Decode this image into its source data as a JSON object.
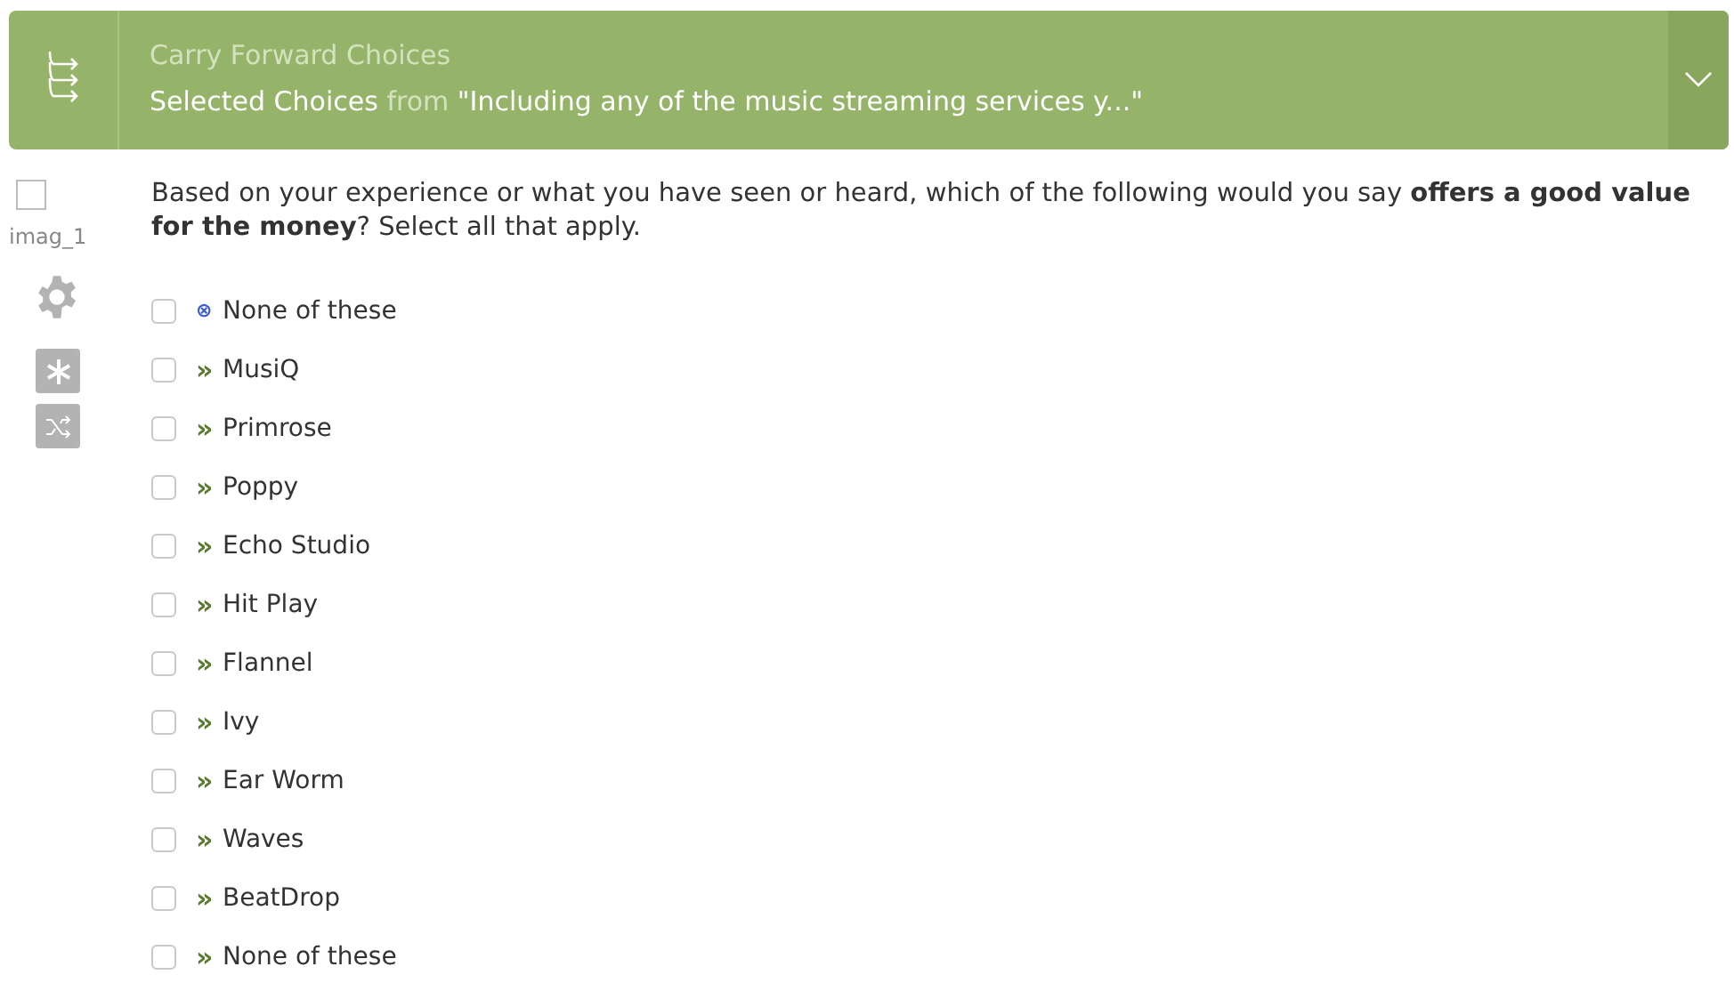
{
  "banner": {
    "title": "Carry Forward Choices",
    "subtitle": {
      "source": "Selected Choices",
      "connector": "from",
      "question": "\"Including any of the music streaming services y...\""
    },
    "expanded": false
  },
  "sidebar": {
    "selected": false,
    "label": "imag_1"
  },
  "question": {
    "text": "Based on your experience or what you have seen or heard, which of the following would you say **offers a good value for the money**? Select all that apply."
  },
  "choices": [
    {
      "kind": "exclusive",
      "marker": "⊗",
      "label": "None of these",
      "checked": false
    },
    {
      "kind": "carried",
      "marker": "»",
      "label": "MusiQ",
      "checked": false
    },
    {
      "kind": "carried",
      "marker": "»",
      "label": "Primrose",
      "checked": false
    },
    {
      "kind": "carried",
      "marker": "»",
      "label": "Poppy",
      "checked": false
    },
    {
      "kind": "carried",
      "marker": "»",
      "label": "Echo Studio",
      "checked": false
    },
    {
      "kind": "carried",
      "marker": "»",
      "label": "Hit Play",
      "checked": false
    },
    {
      "kind": "carried",
      "marker": "»",
      "label": "Flannel",
      "checked": false
    },
    {
      "kind": "carried",
      "marker": "»",
      "label": "Ivy",
      "checked": false
    },
    {
      "kind": "carried",
      "marker": "»",
      "label": "Ear Worm",
      "checked": false
    },
    {
      "kind": "carried",
      "marker": "»",
      "label": "Waves",
      "checked": false
    },
    {
      "kind": "carried",
      "marker": "»",
      "label": "BeatDrop",
      "checked": false
    },
    {
      "kind": "carried",
      "marker": "»",
      "label": "None of these",
      "checked": false
    }
  ]
}
